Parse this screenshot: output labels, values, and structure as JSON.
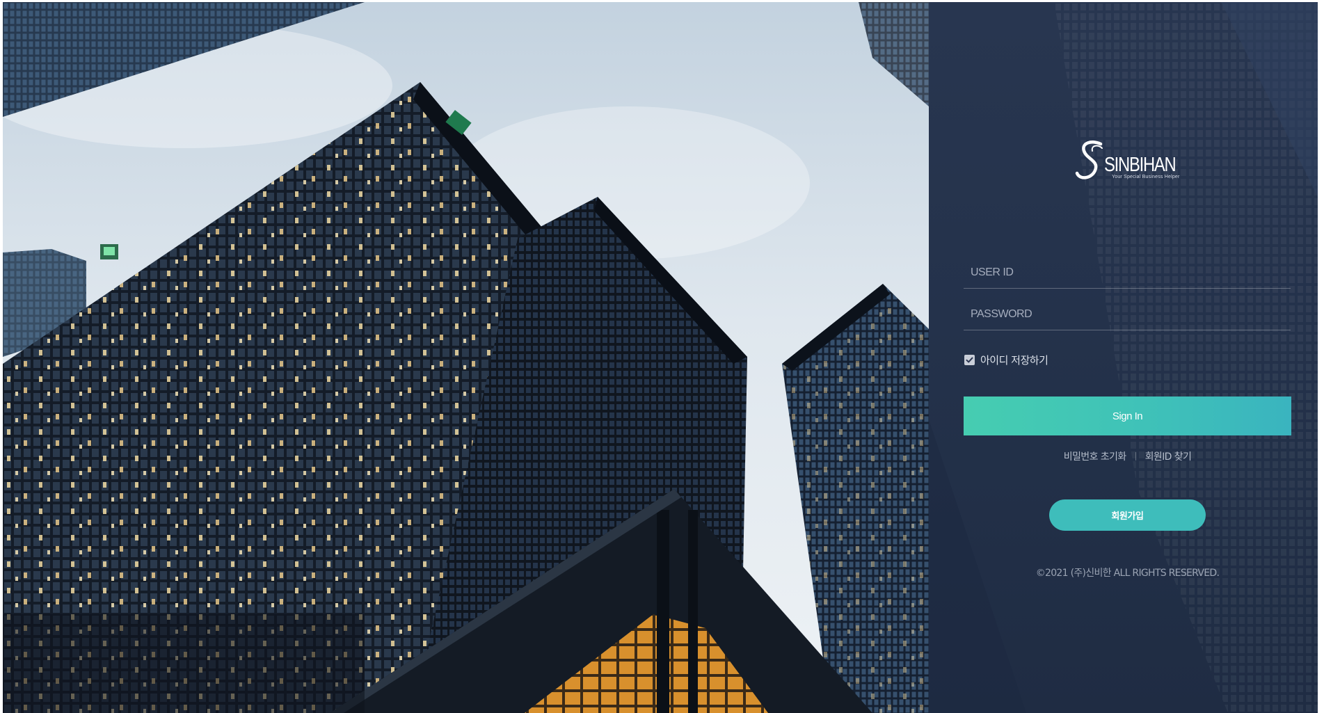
{
  "brand": {
    "name": "SINBIHAN",
    "tagline": "Your Special Business Helper",
    "logo_icon": "script-s-logo"
  },
  "login": {
    "userid_placeholder": "USER ID",
    "userid_value": "",
    "password_placeholder": "PASSWORD",
    "password_value": "",
    "remember_label": "아이디 저장하기",
    "remember_checked": true,
    "signin_label": "Sign In",
    "reset_password_label": "비밀번호 초기화",
    "find_id_label": "회원ID 찾기",
    "join_label": "회원가입"
  },
  "footer": {
    "copyright": "©2021 (주)신비한 ALL RIGHTS RESERVED."
  },
  "colors": {
    "panel_bg": "#24324b",
    "accent_start": "#46cdb1",
    "accent_end": "#3ab4bf",
    "join_bg": "#3ebdbb"
  },
  "background": {
    "scene_icon": "skyscrapers-photo"
  }
}
